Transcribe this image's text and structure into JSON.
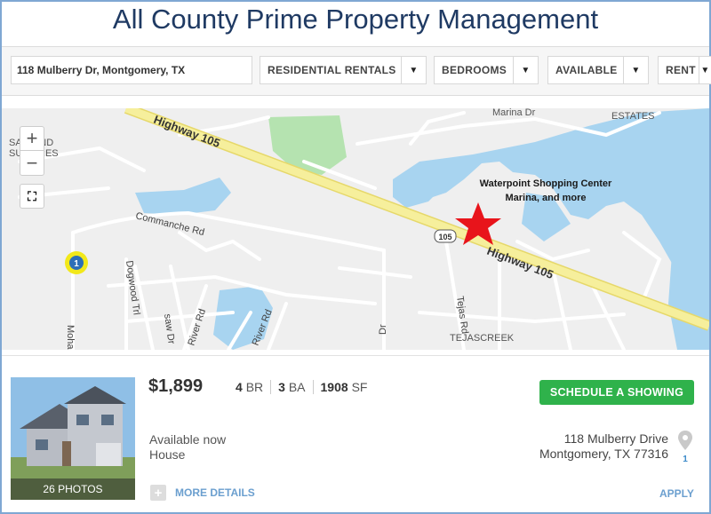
{
  "title": "All County Prime Property Management",
  "search": {
    "value": "118 Mulberry Dr, Montgomery, TX"
  },
  "filters": [
    {
      "label": "RESIDENTIAL RENTALS"
    },
    {
      "label": "BEDROOMS"
    },
    {
      "label": "AVAILABLE"
    },
    {
      "label": "RENT"
    }
  ],
  "map": {
    "labels": {
      "highway_a": "Highway 105",
      "highway_b": "Highway 105",
      "hwy_shield": "105",
      "marina": "Marina Dr",
      "estates": "ESTATES",
      "saddle_1": "SA   E AND",
      "saddle_2": "SU    ACRES",
      "commanche": "Commanche Rd",
      "dogwood": "Dogwood Trl",
      "saw": "saw Dr",
      "river1": "River Rd",
      "river2": "River Rd",
      "tejas": "Tejas Rd",
      "tejascreek": "TEJASCREEK",
      "dr": "Dr",
      "moha": "Mohar"
    },
    "annotation": {
      "line1": "Waterpoint Shopping Center",
      "line2": "Marina, and more"
    },
    "marker_number": "1",
    "colors": {
      "water": "#a8d4f0",
      "park": "#b5e3b0",
      "highway": "#f6ef9c",
      "star": "#e8141b",
      "marker": "#f2e81a"
    }
  },
  "zoom": {
    "in": "+",
    "out": "−"
  },
  "listing": {
    "price": "$1,899",
    "beds": "4",
    "beds_unit": "BR",
    "baths": "3",
    "baths_unit": "BA",
    "sqft": "1908",
    "sqft_unit": "SF",
    "schedule_label": "SCHEDULE A SHOWING",
    "availability": "Available now",
    "type": "House",
    "address_line1": "118 Mulberry Drive",
    "address_line2": "Montgomery, TX 77316",
    "photos_label": "26 PHOTOS",
    "pin_number": "1",
    "more_details": "MORE DETAILS",
    "apply": "APPLY"
  }
}
